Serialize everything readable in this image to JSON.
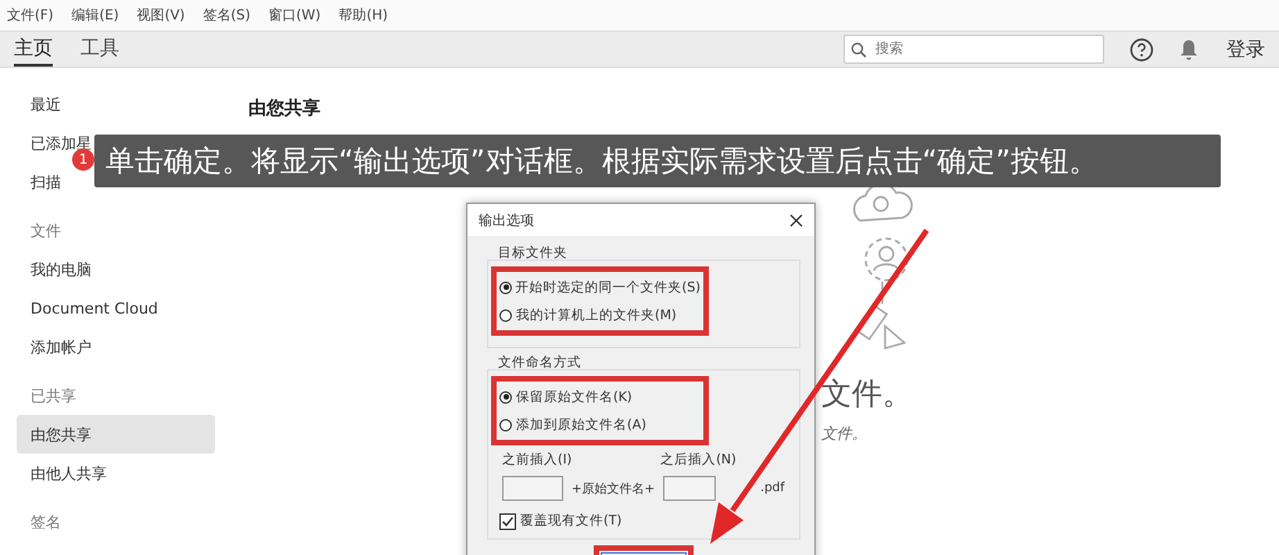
{
  "menu": [
    "文件(F)",
    "编辑(E)",
    "视图(V)",
    "签名(S)",
    "窗口(W)",
    "帮助(H)"
  ],
  "tabs": [
    {
      "label": "主页",
      "selected": true
    },
    {
      "label": "工具",
      "selected": false
    }
  ],
  "search": {
    "placeholder": "搜索"
  },
  "login": "登录",
  "sidebar": [
    {
      "items": [
        {
          "label": "最近",
          "selected": false
        },
        {
          "label": "已添加星",
          "selected": false
        },
        {
          "label": "扫描",
          "selected": false
        }
      ]
    },
    {
      "heading": "文件",
      "items": [
        {
          "label": "我的电脑",
          "selected": false
        },
        {
          "label": "Document Cloud",
          "selected": false
        },
        {
          "label": "添加帐户",
          "selected": false
        }
      ]
    },
    {
      "heading": "已共享",
      "items": [
        {
          "label": "由您共享",
          "selected": true
        },
        {
          "label": "由他人共享",
          "selected": false
        }
      ]
    },
    {
      "heading": "签名"
    }
  ],
  "content": {
    "heading": "由您共享",
    "empty_title": "文件。",
    "empty_subtitle": "文件。"
  },
  "tutorial": {
    "step": "1",
    "text": "单击确定。将显示“输出选项”对话框。根据实际需求设置后点击“确定”按钮。"
  },
  "dialog": {
    "title": "输出选项",
    "groups": [
      {
        "label": "目标文件夹",
        "highlighted": true,
        "options": [
          {
            "label": "开始时选定的同一个文件夹(S)",
            "selected": true
          },
          {
            "label": "我的计算机上的文件夹(M)",
            "selected": false
          }
        ]
      },
      {
        "label": "文件命名方式",
        "highlighted": true,
        "options": [
          {
            "label": "保留原始文件名(K)",
            "selected": true
          },
          {
            "label": "添加到原始文件名(A)",
            "selected": false
          }
        ]
      }
    ],
    "before_label": "之前插入(I)",
    "after_label": "之后插入(N)",
    "middle": "+原始文件名+",
    "suffix": ".pdf",
    "overwrite": {
      "label": "覆盖现有文件(T)",
      "checked": true
    },
    "ok_highlighted": true
  }
}
